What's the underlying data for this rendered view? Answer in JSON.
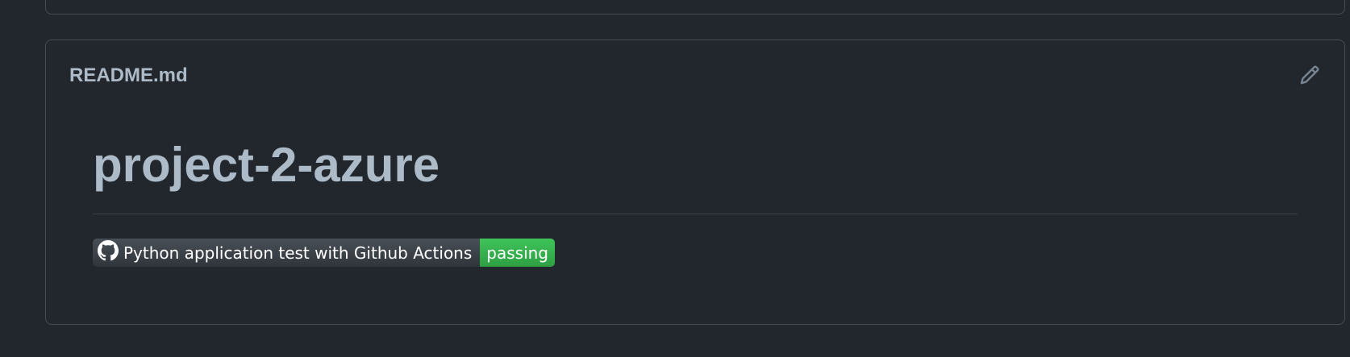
{
  "readme": {
    "filename": "README.md",
    "title": "project-2-azure",
    "badge": {
      "label": "Python application test with Github Actions",
      "status": "passing",
      "status_color": "#2ea043",
      "icon": "github-icon"
    },
    "edit_icon": "pencil-icon"
  },
  "colors": {
    "background": "#22272e",
    "border": "#444c56",
    "text": "#adbac7"
  }
}
